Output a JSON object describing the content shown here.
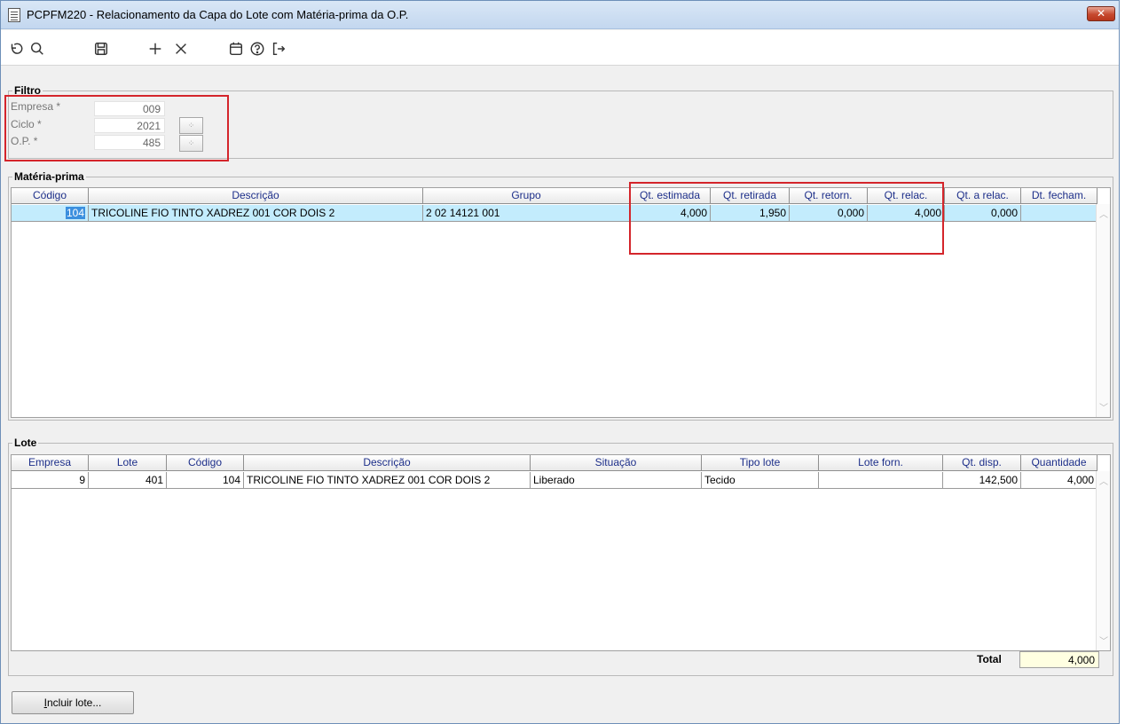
{
  "window": {
    "title": "PCPFM220 - Relacionamento da Capa do Lote com Matéria-prima da O.P.",
    "close_glyph": "✕"
  },
  "toolbar": {
    "icons": [
      "undo-icon",
      "search-icon",
      "save-icon",
      "add-icon",
      "delete-icon",
      "calendar-icon",
      "help-icon",
      "exit-icon"
    ]
  },
  "filtro": {
    "legend": "Filtro",
    "fields": [
      {
        "label": "Empresa *",
        "value": "009"
      },
      {
        "label": "Ciclo *",
        "value": "2021"
      },
      {
        "label": "O.P. *",
        "value": "485"
      }
    ]
  },
  "materia_prima": {
    "legend": "Matéria-prima",
    "columns": [
      "Código",
      "Descrição",
      "Grupo",
      "Qt. estimada",
      "Qt. retirada",
      "Qt. retorn.",
      "Qt. relac.",
      "Qt. a relac.",
      "Dt. fecham."
    ],
    "rows": [
      {
        "codigo": "104",
        "descricao": "TRICOLINE FIO TINTO XADREZ 001 COR DOIS 2",
        "grupo": "2 02 14121 001",
        "qt_estimada": "4,000",
        "qt_retirada": "1,950",
        "qt_retorn": "0,000",
        "qt_relac": "4,000",
        "qt_a_relac": "0,000",
        "dt_fecham": ""
      }
    ]
  },
  "lote": {
    "legend": "Lote",
    "columns": [
      "Empresa",
      "Lote",
      "Código",
      "Descrição",
      "Situação",
      "Tipo lote",
      "Lote forn.",
      "Qt. disp.",
      "Quantidade"
    ],
    "rows": [
      {
        "empresa": "9",
        "lote": "401",
        "codigo": "104",
        "descricao": "TRICOLINE FIO TINTO XADREZ 001 COR DOIS 2",
        "situacao": "Liberado",
        "tipo_lote": "Tecido",
        "lote_forn": "",
        "qt_disp": "142,500",
        "quantidade": "4,000"
      }
    ],
    "total_label": "Total",
    "total_value": "4,000"
  },
  "actions": {
    "incluir_lote_label_u": "I",
    "incluir_lote_label_rest": "ncluir lote..."
  },
  "colors": {
    "highlight": "#d4252b",
    "selected_row": "#c3ecfd",
    "header_text": "#1d2f8a"
  }
}
